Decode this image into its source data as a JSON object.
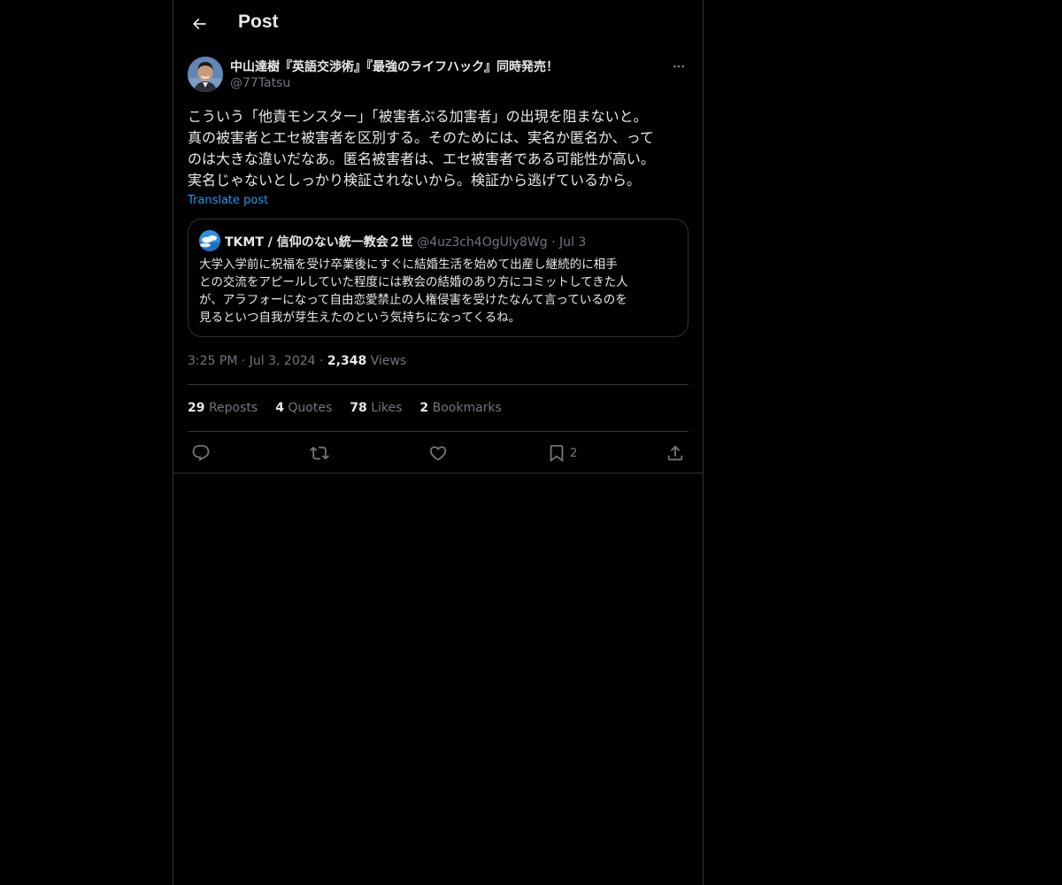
{
  "header": {
    "title": "Post",
    "back_icon": "arrow-left-icon"
  },
  "post": {
    "author_name": "中山達樹『英語交渉術』『最強のライフハック』同時発売！",
    "author_handle": "@77Tatsu",
    "text": "こういう「他責モンスター」「被害者ぶる加害者」の出現を阻まないと。\n真の被害者とエセ被害者を区別する。そのためには、実名か匿名か、って\nのは大きな違いだなあ。匿名被害者は、エセ被害者である可能性が高い。\n実名じゃないとしっかり検証されないから。検証から逃げているから。",
    "translate_label": "Translate post",
    "quote": {
      "name": "TKMT / 信仰のない統一教会２世",
      "handle": "@4uz3ch4OgUly8Wg",
      "separator": "·",
      "date": "Jul 3",
      "text": "大学入学前に祝福を受け卒業後にすぐに結婚生活を始めて出産し継続的に相手\nとの交流をアピールしていた程度には教会の結婚のあり方にコミットしてきた人\nが、アラフォーになって自由恋愛禁止の人権侵害を受けたなんて言っているのを\n見るといつ自我が芽生えたのという気持ちになってくるね。"
    },
    "time": "3:25 PM",
    "date": "Jul 3, 2024",
    "separator": "·",
    "views_count": "2,348",
    "views_label": "Views",
    "stats": {
      "reposts_count": "29",
      "reposts_label": "Reposts",
      "quotes_count": "4",
      "quotes_label": "Quotes",
      "likes_count": "78",
      "likes_label": "Likes",
      "bookmarks_count": "2",
      "bookmarks_label": "Bookmarks"
    },
    "actions": {
      "reply_icon": "reply-icon",
      "repost_icon": "repost-icon",
      "like_icon": "heart-icon",
      "bookmark_icon": "bookmark-icon",
      "bookmark_count": "2",
      "share_icon": "share-icon"
    }
  },
  "colors": {
    "background": "#000000",
    "text": "#e7e9ea",
    "secondary_text": "#71767b",
    "link": "#1d9bf0",
    "border": "#2f3336"
  }
}
